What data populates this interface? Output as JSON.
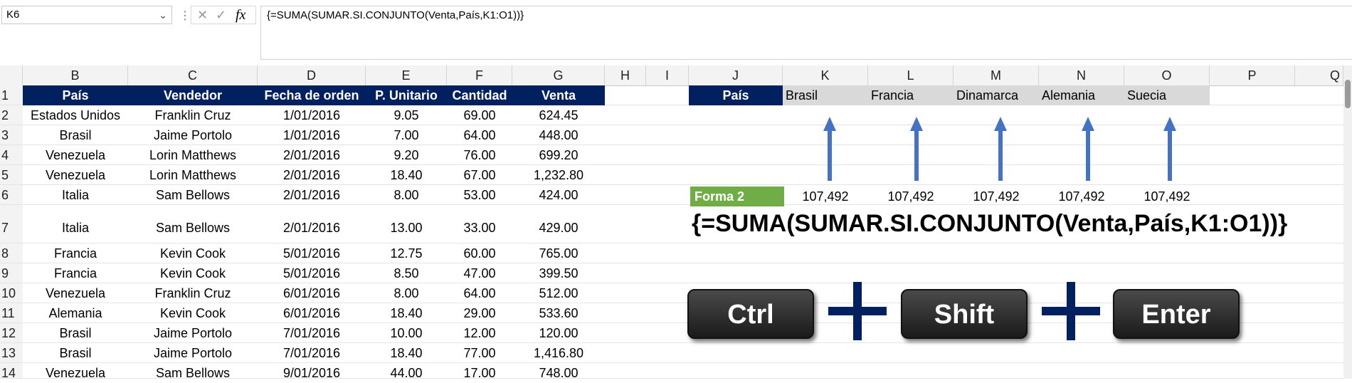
{
  "formula_bar": {
    "name_box": "K6",
    "formula": "{=SUMA(SUMAR.SI.CONJUNTO(Venta,País,K1:O1))}",
    "cancel_glyph": "✕",
    "enter_glyph": "✓",
    "fx_glyph": "fx"
  },
  "columns": [
    "B",
    "C",
    "D",
    "E",
    "F",
    "G",
    "H",
    "I",
    "J",
    "K",
    "L",
    "M",
    "N",
    "O",
    "P",
    "Q"
  ],
  "rows": [
    "1",
    "2",
    "3",
    "4",
    "5",
    "6",
    "7",
    "8",
    "9",
    "10",
    "11",
    "12",
    "13",
    "14"
  ],
  "table": {
    "headers": [
      "País",
      "Vendedor",
      "Fecha de orden",
      "P. Unitario",
      "Cantidad",
      "Venta"
    ],
    "data": [
      [
        "Estados Unidos",
        "Franklin Cruz",
        "1/01/2016",
        "9.05",
        "69.00",
        "624.45"
      ],
      [
        "Brasil",
        "Jaime Portolo",
        "1/01/2016",
        "7.00",
        "64.00",
        "448.00"
      ],
      [
        "Venezuela",
        "Lorin Matthews",
        "2/01/2016",
        "9.20",
        "76.00",
        "699.20"
      ],
      [
        "Venezuela",
        "Lorin Matthews",
        "2/01/2016",
        "18.40",
        "67.00",
        "1,232.80"
      ],
      [
        "Italia",
        "Sam Bellows",
        "2/01/2016",
        "8.00",
        "53.00",
        "424.00"
      ],
      [
        "Italia",
        "Sam Bellows",
        "2/01/2016",
        "13.00",
        "33.00",
        "429.00"
      ],
      [
        "Francia",
        "Kevin Cook",
        "5/01/2016",
        "12.75",
        "60.00",
        "765.00"
      ],
      [
        "Francia",
        "Kevin Cook",
        "5/01/2016",
        "8.50",
        "47.00",
        "399.50"
      ],
      [
        "Venezuela",
        "Franklin Cruz",
        "6/01/2016",
        "8.00",
        "64.00",
        "512.00"
      ],
      [
        "Alemania",
        "Kevin Cook",
        "6/01/2016",
        "18.40",
        "29.00",
        "533.60"
      ],
      [
        "Brasil",
        "Jaime Portolo",
        "7/01/2016",
        "10.00",
        "12.00",
        "120.00"
      ],
      [
        "Brasil",
        "Jaime Portolo",
        "7/01/2016",
        "18.40",
        "77.00",
        "1,416.80"
      ],
      [
        "Venezuela",
        "Sam Bellows",
        "9/01/2016",
        "44.00",
        "17.00",
        "748.00"
      ]
    ]
  },
  "criteria": {
    "label": "País",
    "countries": [
      "Brasil",
      "Francia",
      "Dinamarca",
      "Alemania",
      "Suecia"
    ]
  },
  "results": {
    "label": "Forma 2",
    "values": [
      "107,492",
      "107,492",
      "107,492",
      "107,492",
      "107,492"
    ]
  },
  "big_formula": "{=SUMA(SUMAR.SI.CONJUNTO(Venta,País,K1:O1))}",
  "keys": [
    "Ctrl",
    "Shift",
    "Enter"
  ],
  "colors": {
    "header_bg": "#002060",
    "criteria_bg": "#d9d9d9",
    "forma_bg": "#70ad47",
    "arrow": "#4472c4",
    "plus": "#002060"
  }
}
